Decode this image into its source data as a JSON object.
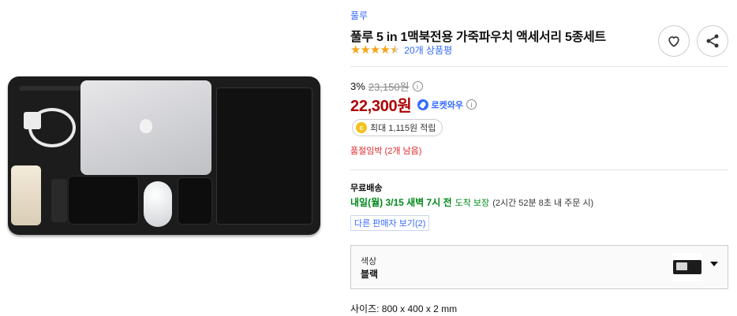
{
  "product": {
    "brand": "풀루",
    "title": "풀루 5 in 1맥북전용 가죽파우치 액세서리 5종세트",
    "rating": 4.5,
    "review_count": "20개 상품평"
  },
  "actions": {
    "wishlist_icon": "heart-icon",
    "share_icon": "share-icon"
  },
  "price": {
    "discount_rate": "3%",
    "original_price": "23,150원",
    "sale_price": "22,300원",
    "rocket_label": "로켓와우",
    "info_glyph": "i"
  },
  "cash": {
    "coin_glyph": "c",
    "text": "최대 1,115원 적립"
  },
  "stock": {
    "text": "품절임박 (2개 남음)"
  },
  "shipping": {
    "label": "무료배송",
    "date": "내일(월) 3/15 새벽 7시 전",
    "note": "도착 보장",
    "extra": "(2시간 52분 8초 내 주문 시)"
  },
  "seller": {
    "button_label": "다른 판매자 보기(2)"
  },
  "option": {
    "label": "색상",
    "value": "블랙"
  },
  "spec": {
    "size": "사이즈:  800 x 400 x 2 mm"
  },
  "colors": {
    "link_blue": "#346aff",
    "price_red": "#ae0000",
    "delivery_green": "#00891a",
    "alert_red": "#e52528",
    "star_orange": "#f8a51c"
  }
}
